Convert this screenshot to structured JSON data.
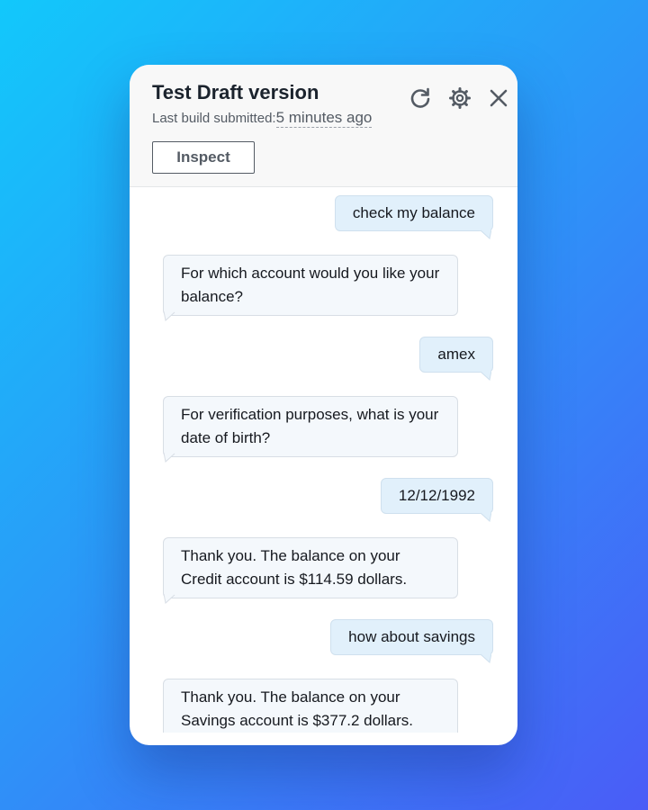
{
  "header": {
    "title": "Test Draft version",
    "subtitle_label": "Last build submitted:",
    "subtitle_time": "5 minutes ago",
    "inspect_label": "Inspect",
    "icons": [
      "refresh-icon",
      "settings-gear-icon",
      "close-icon"
    ]
  },
  "messages": [
    {
      "role": "user",
      "text": "check my balance"
    },
    {
      "role": "bot",
      "text": "For which account would you like your balance?"
    },
    {
      "role": "user",
      "text": "amex"
    },
    {
      "role": "bot",
      "text": "For verification purposes, what is your date of birth?"
    },
    {
      "role": "user",
      "text": "12/12/1992"
    },
    {
      "role": "bot",
      "text": "Thank you. The balance on your Credit account is $114.59 dollars."
    },
    {
      "role": "user",
      "text": "how about savings"
    },
    {
      "role": "bot",
      "text": "Thank you. The balance on your Savings account is $377.2 dollars."
    }
  ],
  "colors": {
    "user_bubble": "#e1f0fb",
    "bot_bubble": "#f4f8fc",
    "title_text": "#1b232d",
    "icon_gray": "#545b64"
  }
}
